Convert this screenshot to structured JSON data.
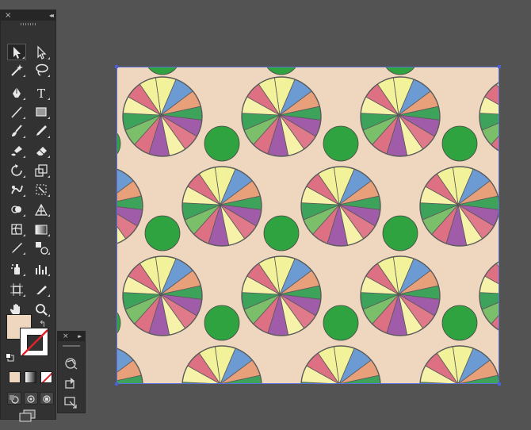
{
  "app": {
    "canvas_background": "#535353",
    "artboard_color": "#efd7bf",
    "selection_color": "#4a5fd8"
  },
  "tools_panel": {
    "close_glyph": "×",
    "collapse_glyph": "◂◂",
    "tools": [
      "selection-tool",
      "direct-selection-tool",
      "magic-wand-tool",
      "lasso-tool",
      "pen-tool",
      "type-tool",
      "line-segment-tool",
      "rectangle-tool",
      "paintbrush-tool",
      "pencil-tool",
      "blob-brush-tool",
      "eraser-tool",
      "rotate-tool",
      "scale-tool",
      "warp-tool",
      "free-transform-tool",
      "shape-builder-tool",
      "perspective-grid-tool",
      "mesh-tool",
      "gradient-tool",
      "eyedropper-tool",
      "blend-tool",
      "symbol-sprayer-tool",
      "column-graph-tool",
      "artboard-tool",
      "slice-tool",
      "hand-tool",
      "zoom-tool"
    ],
    "active_tool": "selection-tool",
    "type_tool_glyph": "T",
    "fill_color": "#efd7bf",
    "stroke": "none",
    "swap_glyph": "↰"
  },
  "floating_panel": {
    "close_glyph": "×",
    "collapse_glyph": "▸▸",
    "items": [
      "symbol-sprayer-icon",
      "place-symbol-icon",
      "break-link-icon"
    ]
  },
  "pattern": {
    "fill_colors": [
      "#6b9bd2",
      "#e8a07a",
      "#3da35a",
      "#de7084",
      "#a05ca8",
      "#f2f29a",
      "#7cbf6a",
      "#f6f2aa",
      "#e07a8a"
    ],
    "dot_color": "#2fa33f"
  }
}
